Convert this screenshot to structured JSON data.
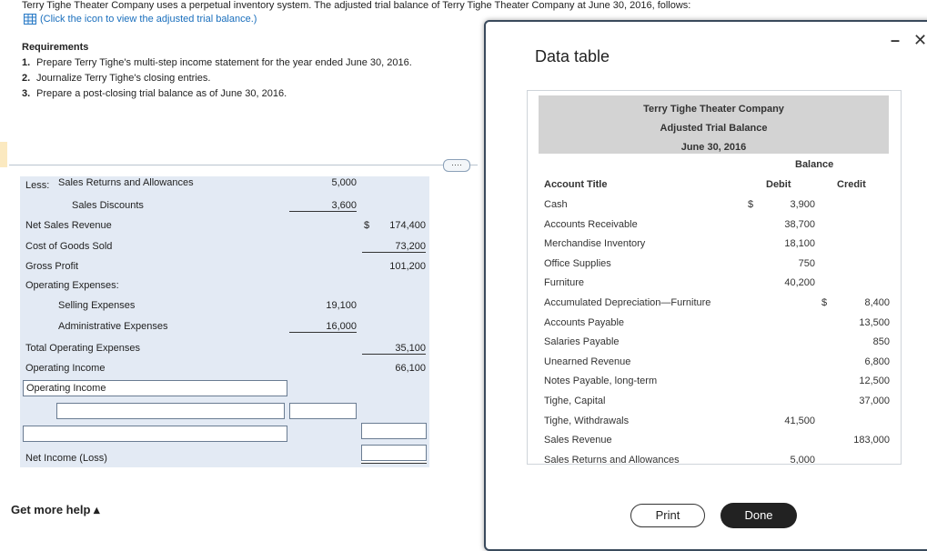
{
  "intro": {
    "text": "Terry Tighe Theater Company uses a perpetual inventory system. The adjusted trial balance of Terry Tighe Theater Company at June 30, 2016, follows:",
    "link": "(Click the icon to view the adjusted trial balance.)"
  },
  "requirements": {
    "title": "Requirements",
    "items": [
      {
        "num": "1.",
        "text": "Prepare Terry Tighe's multi-step income statement for the year ended June 30, 2016."
      },
      {
        "num": "2.",
        "text": "Journalize Terry Tighe's closing entries."
      },
      {
        "num": "3.",
        "text": "Prepare a post-closing trial balance as of June 30, 2016."
      }
    ]
  },
  "ellipsis": "····",
  "statement": {
    "less": "Less:",
    "rows": [
      {
        "label": "Sales Returns and Allowances",
        "c1": "5,000"
      },
      {
        "label": "Sales Discounts",
        "c1": "3,600"
      },
      {
        "label": "Net Sales Revenue",
        "dollar": "$",
        "c2": "174,400"
      },
      {
        "label": "Cost of Goods Sold",
        "c2": "73,200"
      },
      {
        "label": "Gross Profit",
        "c2": "101,200"
      },
      {
        "label": "Operating Expenses:"
      },
      {
        "label": "Selling Expenses",
        "c1": "19,100"
      },
      {
        "label": "Administrative Expenses",
        "c1": "16,000"
      },
      {
        "label": "Total Operating Expenses",
        "c2": "35,100"
      },
      {
        "label": "Operating Income",
        "c2": "66,100"
      }
    ],
    "input_operating_income": "Operating Income",
    "net_income_label": "Net Income (Loss)"
  },
  "help": "Get more help ▴",
  "modal": {
    "title": "Data table",
    "minimize": "–",
    "close": "✕",
    "heading": [
      "Terry Tighe Theater Company",
      "Adjusted Trial Balance",
      "June 30, 2016"
    ],
    "balance_label": "Balance",
    "col_account": "Account Title",
    "col_debit": "Debit",
    "col_credit": "Credit",
    "rows": [
      {
        "account": "Cash",
        "dsign": "$",
        "debit": "3,900",
        "credit": ""
      },
      {
        "account": "Accounts Receivable",
        "debit": "38,700",
        "credit": ""
      },
      {
        "account": "Merchandise Inventory",
        "debit": "18,100",
        "credit": ""
      },
      {
        "account": "Office Supplies",
        "debit": "750",
        "credit": ""
      },
      {
        "account": "Furniture",
        "debit": "40,200",
        "credit": ""
      },
      {
        "account": "Accumulated Depreciation—Furniture",
        "debit": "",
        "csign": "$",
        "credit": "8,400"
      },
      {
        "account": "Accounts Payable",
        "debit": "",
        "credit": "13,500"
      },
      {
        "account": "Salaries Payable",
        "debit": "",
        "credit": "850"
      },
      {
        "account": "Unearned Revenue",
        "debit": "",
        "credit": "6,800"
      },
      {
        "account": "Notes Payable, long-term",
        "debit": "",
        "credit": "12,500"
      },
      {
        "account": "Tighe, Capital",
        "debit": "",
        "credit": "37,000"
      },
      {
        "account": "Tighe, Withdrawals",
        "debit": "41,500",
        "credit": ""
      },
      {
        "account": "Sales Revenue",
        "debit": "",
        "credit": "183,000"
      },
      {
        "account": "Sales Returns and Allowances",
        "debit": "5,000",
        "credit": ""
      }
    ],
    "print": "Print",
    "done": "Done"
  }
}
